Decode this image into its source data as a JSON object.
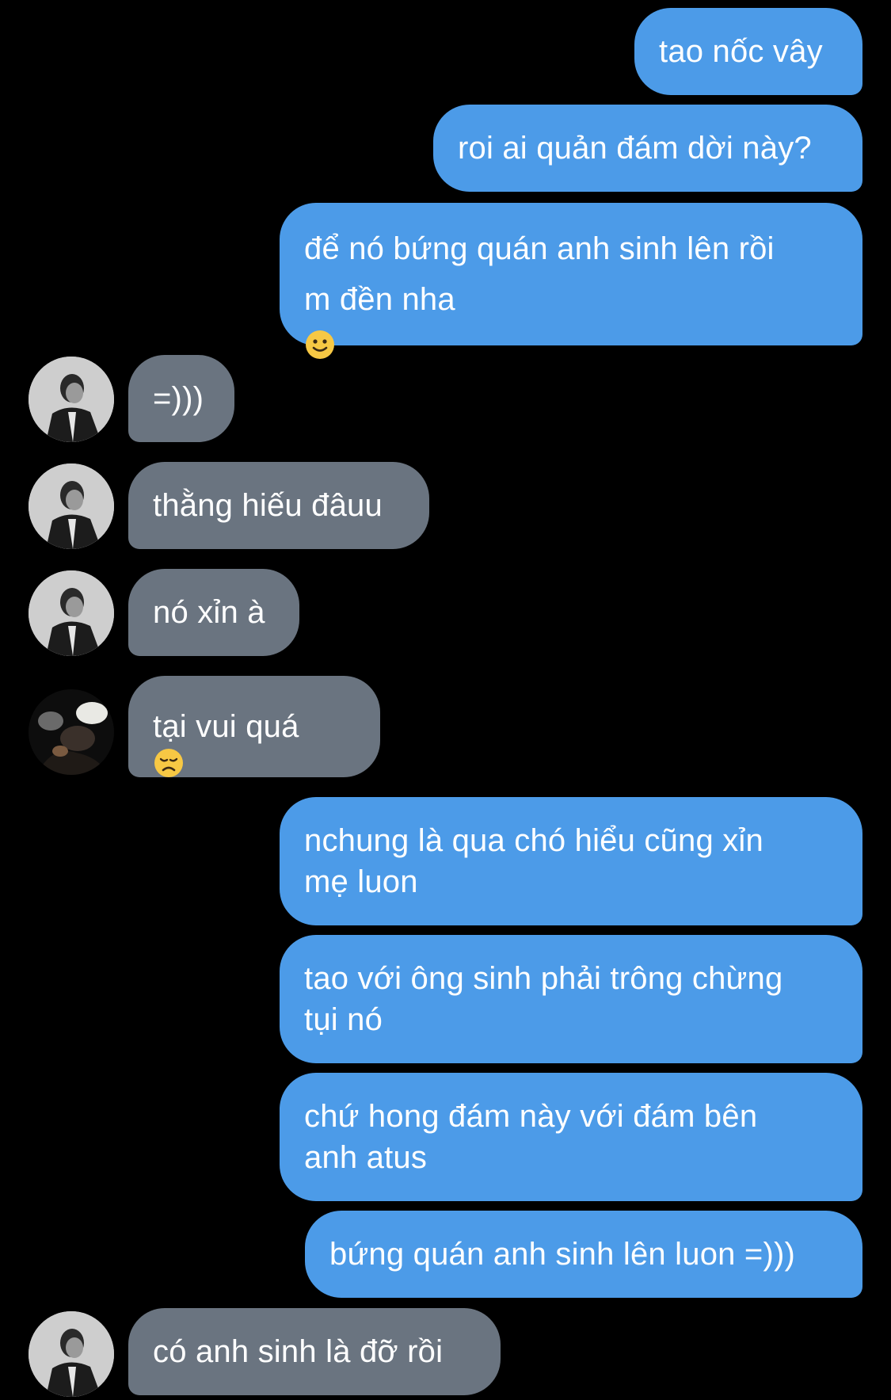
{
  "conversation": {
    "messages": [
      {
        "sender": "me",
        "text": "tao nốc vây"
      },
      {
        "sender": "me",
        "text": "roi ai quản đám dời này?"
      },
      {
        "sender": "me",
        "text": "để nó bứng quán anh sinh lên rồi\nm đền nha",
        "emoji": "slightly-smiling-face"
      },
      {
        "sender": "other",
        "text": "=)))",
        "avatar": "profile-photo-grayscale"
      },
      {
        "sender": "other",
        "text": "thằng hiếu đâuu",
        "avatar": "profile-photo-grayscale"
      },
      {
        "sender": "other",
        "text": "nó xỉn à",
        "avatar": "profile-photo-grayscale"
      },
      {
        "sender": "other",
        "text": "tại vui quá",
        "emoji": "disappointed-face",
        "avatar": "profile-photo-dark"
      },
      {
        "sender": "me",
        "text": "nchung là qua chó hiểu cũng xỉn\nmẹ luon"
      },
      {
        "sender": "me",
        "text": "tao với ông sinh phải trông chừng\ntụi nó"
      },
      {
        "sender": "me",
        "text": "chứ hong đám này với đám bên\nanh atus"
      },
      {
        "sender": "me",
        "text": "bứng quán anh sinh lên luon =)))"
      },
      {
        "sender": "other",
        "text": "có anh sinh là đỡ rồi",
        "avatar": "profile-photo-grayscale"
      }
    ]
  },
  "colors": {
    "background": "#000000",
    "outgoing_bubble": "#4c9be8",
    "incoming_bubble": "#6a7480",
    "text": "#ffffff"
  }
}
